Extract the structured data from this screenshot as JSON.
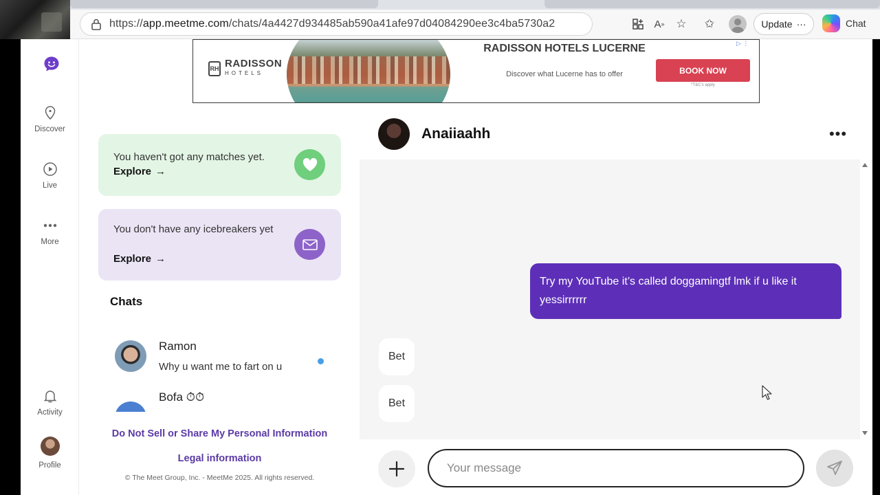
{
  "browser": {
    "url_protocol": "https://",
    "url_domain": "app.meetme.com",
    "url_path": "/chats/4a4427d934485ab590a41afe97d04084290ee3c4ba5730a2",
    "update_label": "Update",
    "chat_label": "Chat"
  },
  "sidebar": {
    "items": [
      {
        "label": "Discover"
      },
      {
        "label": "Live"
      },
      {
        "label": "More"
      },
      {
        "label": "Activity"
      },
      {
        "label": "Profile"
      }
    ]
  },
  "ad": {
    "brand": "RADISSON",
    "brand_sub": "HOTELS",
    "mark": "RH",
    "title": "RADISSON HOTELS LUCERNE",
    "subtitle": "Discover what Lucerne has to offer",
    "cta": "BOOK NOW",
    "terms": "*T&C's apply"
  },
  "cards": {
    "matches": {
      "text": "You haven't got any matches yet.",
      "cta": "Explore",
      "color": "#6fcf7c"
    },
    "icebreakers": {
      "text": "You don't have any icebreakers yet",
      "cta": "Explore",
      "color": "#8d63c9"
    }
  },
  "chats": {
    "heading": "Chats",
    "items": [
      {
        "name": "Ramon",
        "preview": "Why u want me to fart on u",
        "unread": true
      },
      {
        "name": "Bofa",
        "preview": "",
        "unread": false
      }
    ]
  },
  "footer": {
    "privacy_link": "Do Not Sell or Share My Personal Information",
    "legal_link": "Legal information",
    "copyright": "© The Meet Group, Inc. - MeetMe 2025. All rights reserved."
  },
  "conversation": {
    "contact_name": "Anaiiaahh",
    "messages": [
      {
        "direction": "outgoing",
        "text": "Try my YouTube it’s called doggamingtf lmk if u like it yessirrrrrr"
      },
      {
        "direction": "incoming",
        "text": "Bet"
      },
      {
        "direction": "incoming",
        "text": "Bet"
      }
    ],
    "composer_placeholder": "Your message"
  },
  "colors": {
    "brand_purple": "#5d2fb8",
    "link_purple": "#5b3aa6",
    "unread_blue": "#4a9ee8",
    "cta_red": "#d84252"
  }
}
